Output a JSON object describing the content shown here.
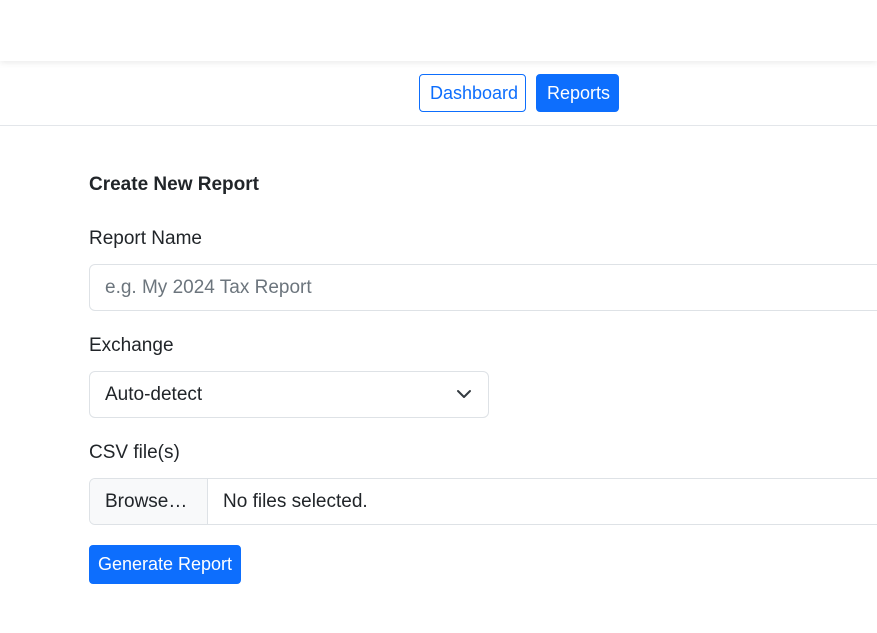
{
  "nav": {
    "dashboard_label": "Dashboard",
    "reports_label": "Reports",
    "active": "Reports"
  },
  "form": {
    "title": "Create New Report",
    "report_name": {
      "label": "Report Name",
      "value": "",
      "placeholder": "e.g. My 2024 Tax Report"
    },
    "exchange": {
      "label": "Exchange",
      "selected": "Auto-detect",
      "icon": "chevron-down-icon"
    },
    "csv": {
      "label": "CSV file(s)",
      "browse_label": "Browse…",
      "status": "No files selected."
    },
    "submit_label": "Generate Report"
  },
  "colors": {
    "primary": "#0d6efd",
    "border": "#dee2e6",
    "text": "#212529",
    "placeholder": "#6c757d"
  }
}
